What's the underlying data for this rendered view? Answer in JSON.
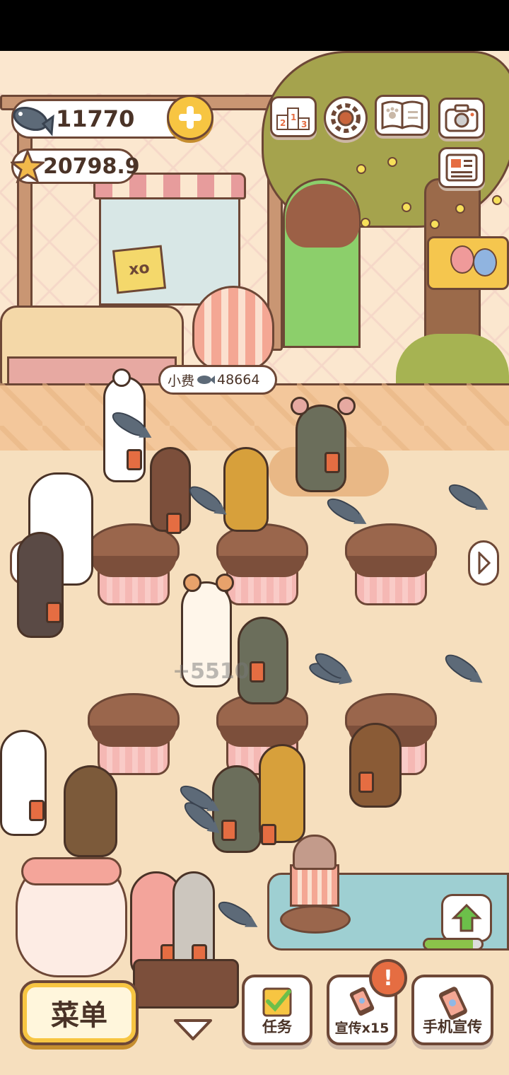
{
  "hud": {
    "fish_count": "11770",
    "star_count": "20798.9"
  },
  "tip_bubble": {
    "label": "小费",
    "value": "48664"
  },
  "floating_score": "+5510",
  "shop_sign": "xo",
  "bottom_bar": {
    "menu_label": "菜单",
    "task_label": "任务",
    "promo_label": "宣传x15",
    "phone_promo_label": "手机宣传",
    "alert_badge": "!"
  },
  "upgrade": {
    "progress": 0.85
  },
  "colors": {
    "outline": "#6d4736",
    "gold": "#f7c542",
    "fish": "#5d6a78",
    "wall": "#fbe7cf",
    "floor": "#f6dfbe",
    "alert": "#e56d42"
  },
  "icons": {
    "fish": "fish-icon",
    "star": "star-icon",
    "plus": "plus-icon",
    "ranking": "ranking-icon",
    "settings": "gear-icon",
    "book": "paw-book-icon",
    "camera": "camera-icon",
    "newspaper": "newspaper-icon",
    "balloon_event": "balloon-event-icon",
    "left_arrow": "chevron-left-icon",
    "right_arrow": "chevron-right-icon",
    "down_arrow": "chevron-down-icon",
    "task": "checklist-icon",
    "promo": "phone-promo-icon",
    "upgrade": "upgrade-arrow-icon"
  }
}
